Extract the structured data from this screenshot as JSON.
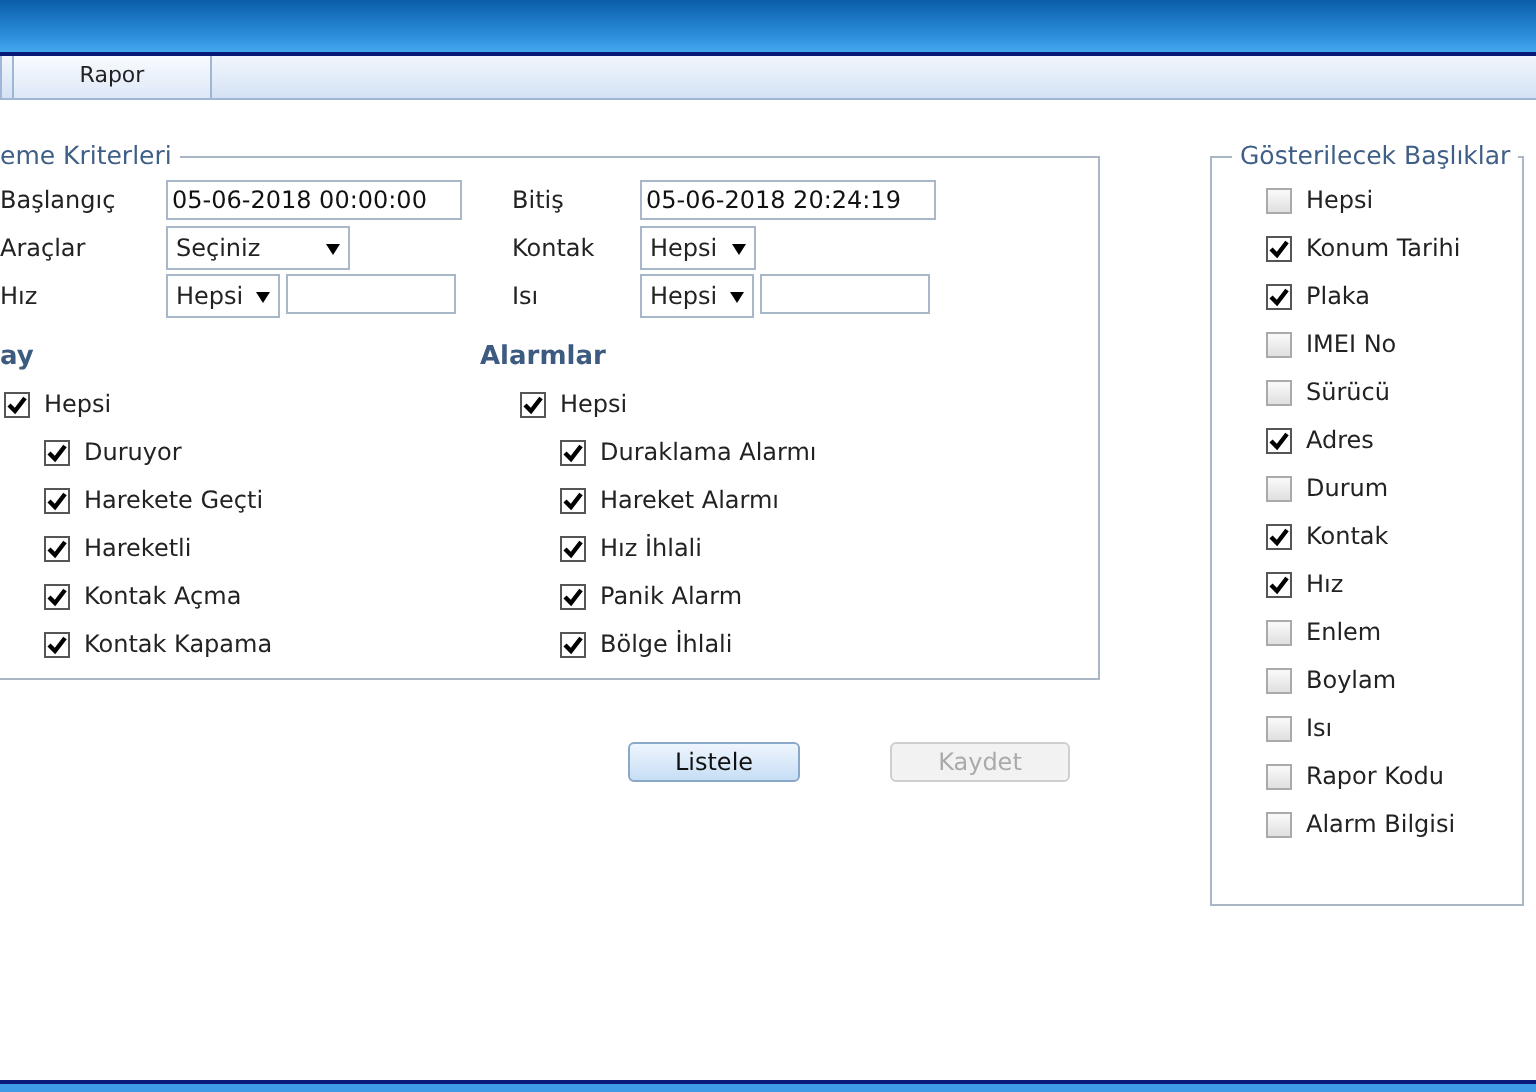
{
  "tabs": [
    {
      "label": "Rapor"
    }
  ],
  "criteria": {
    "legend": "eme Kriterleri",
    "fields": [
      {
        "label": "Başlangıç",
        "kind": "text",
        "value": "05-06-2018 00:00:00"
      },
      {
        "label": "Bitiş",
        "kind": "text",
        "value": "05-06-2018 20:24:19"
      },
      {
        "label": "Araçlar",
        "kind": "select",
        "value": "Seçiniz"
      },
      {
        "label": "Kontak",
        "kind": "select",
        "value": "Hepsi"
      },
      {
        "label": "Hız",
        "kind": "select_text",
        "value": "Hepsi"
      },
      {
        "label": "Isı",
        "kind": "select_text",
        "value": "Hepsi"
      }
    ],
    "groups": [
      {
        "title": "ay",
        "all": {
          "label": "Hepsi",
          "checked": true
        },
        "items": [
          {
            "label": "Duruyor",
            "checked": true
          },
          {
            "label": "Harekete Geçti",
            "checked": true
          },
          {
            "label": "Hareketli",
            "checked": true
          },
          {
            "label": "Kontak Açma",
            "checked": true
          },
          {
            "label": "Kontak Kapama",
            "checked": true
          }
        ]
      },
      {
        "title": "Alarmlar",
        "all": {
          "label": "Hepsi",
          "checked": true
        },
        "items": [
          {
            "label": "Duraklama Alarmı",
            "checked": true
          },
          {
            "label": "Hareket Alarmı",
            "checked": true
          },
          {
            "label": "Hız İhlali",
            "checked": true
          },
          {
            "label": "Panik Alarm",
            "checked": true
          },
          {
            "label": "Bölge İhlali",
            "checked": true
          }
        ]
      }
    ]
  },
  "buttons": [
    {
      "label": "Listele",
      "disabled": false
    },
    {
      "label": "Kaydet",
      "disabled": true
    }
  ],
  "columns": {
    "legend": "Gösterilecek Başlıklar",
    "items": [
      {
        "label": "Hepsi",
        "checked": false
      },
      {
        "label": "Konum Tarihi",
        "checked": true
      },
      {
        "label": "Plaka",
        "checked": true
      },
      {
        "label": "IMEI No",
        "checked": false
      },
      {
        "label": "Sürücü",
        "checked": false
      },
      {
        "label": "Adres",
        "checked": true
      },
      {
        "label": "Durum",
        "checked": false
      },
      {
        "label": "Kontak",
        "checked": true
      },
      {
        "label": "Hız",
        "checked": true
      },
      {
        "label": "Enlem",
        "checked": false
      },
      {
        "label": "Boylam",
        "checked": false
      },
      {
        "label": "Isı",
        "checked": false
      },
      {
        "label": "Rapor Kodu",
        "checked": false
      },
      {
        "label": "Alarm Bilgisi",
        "checked": false
      }
    ]
  }
}
